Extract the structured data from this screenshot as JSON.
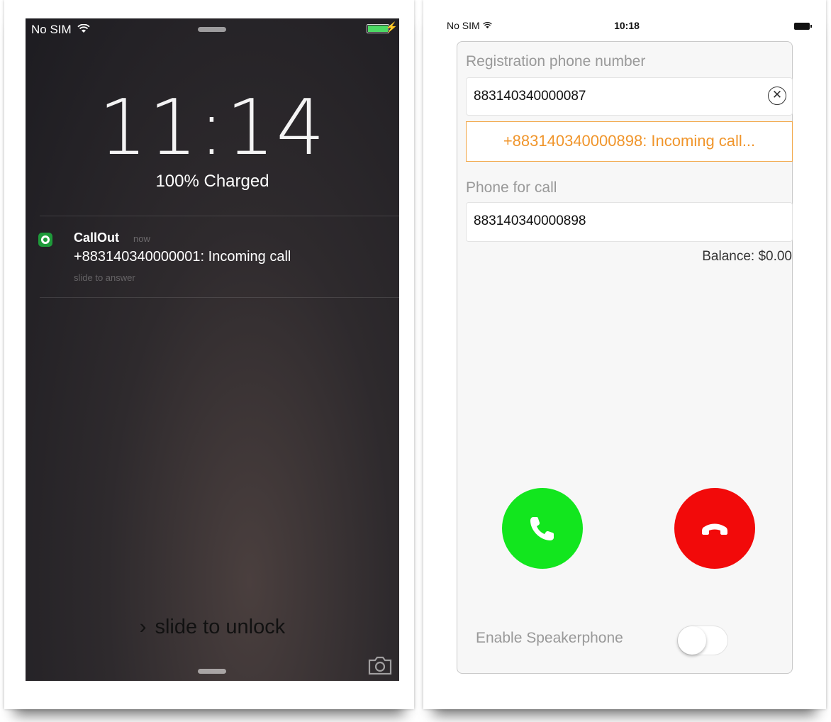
{
  "lock_screen": {
    "status_bar": {
      "carrier": "No SIM",
      "wifi_icon": "wifi-icon",
      "battery_level": 1.0
    },
    "time": "11:14",
    "charge_status": "100% Charged",
    "notification": {
      "app_name": "CallOut",
      "when": "now",
      "message": "+883140340000001: Incoming call",
      "action": "slide to answer"
    },
    "unlock": {
      "chevron": "›",
      "label": "slide to unlock"
    },
    "icons": [
      "wifi-icon",
      "camera-icon",
      "callout-app-icon"
    ]
  },
  "app": {
    "status_bar": {
      "carrier": "No SIM",
      "time": "10:18"
    },
    "registration": {
      "label": "Registration phone number",
      "value": "883140340000087",
      "clear_icon": "clear-circle-icon",
      "clear_glyph": "✕"
    },
    "call_status": "+883140340000898: Incoming call...",
    "call_phone": {
      "label": "Phone for call",
      "value": "883140340000898"
    },
    "balance": "Balance: $0.00",
    "accept_button": {
      "icon": "phone-accept-icon",
      "color": "#12e61e"
    },
    "decline_button": {
      "icon": "phone-hangup-icon",
      "color": "#f20a0a"
    },
    "speakerphone": {
      "label": "Enable Speakerphone",
      "on": false
    },
    "accent_color": "#f0952b"
  }
}
